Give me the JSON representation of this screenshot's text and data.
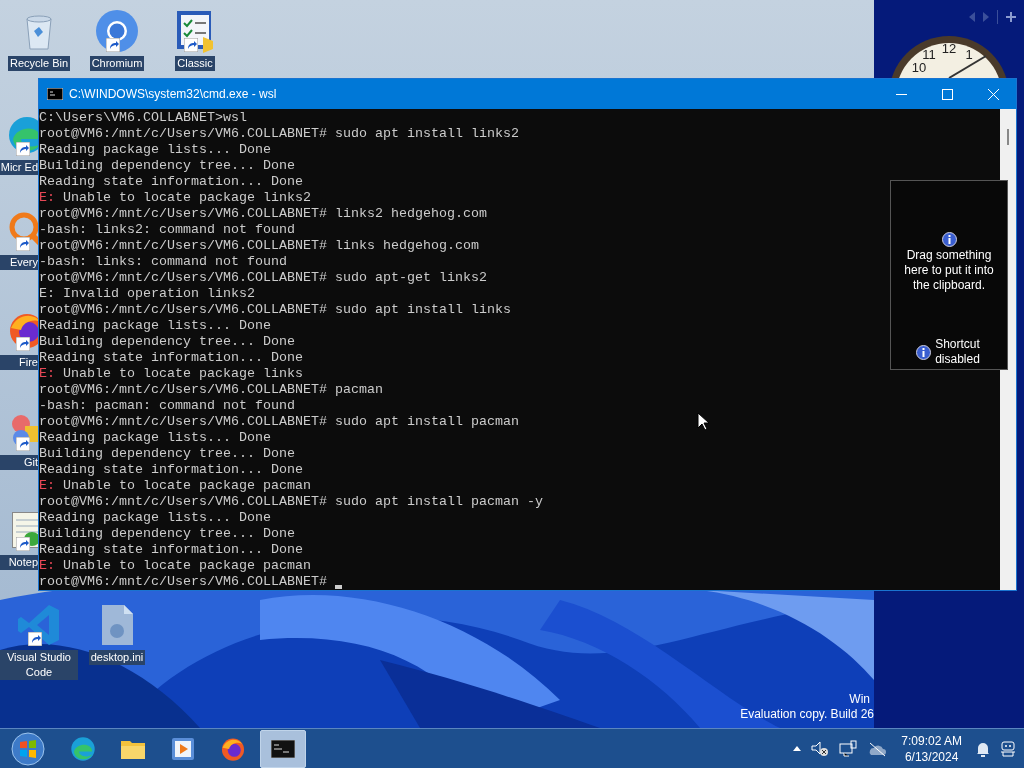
{
  "desktop": {
    "icons": [
      {
        "kind": "bin",
        "label": "Recycle Bin",
        "shortcut": false,
        "cut": false
      },
      {
        "kind": "chromium",
        "label": "Chromium",
        "shortcut": true,
        "cut": false
      },
      {
        "kind": "checklist",
        "label": "Classic",
        "shortcut": true,
        "cut": false
      },
      {
        "kind": "edge",
        "label": "Micr Ed",
        "shortcut": true,
        "cut": true
      },
      {
        "kind": "search",
        "label": "Every",
        "shortcut": true,
        "cut": true
      },
      {
        "kind": "firefox",
        "label": "Fire",
        "shortcut": true,
        "cut": true
      },
      {
        "kind": "git",
        "label": "Git",
        "shortcut": true,
        "cut": true
      },
      {
        "kind": "notepad",
        "label": "Notep",
        "shortcut": true,
        "cut": true
      },
      {
        "kind": "vscode",
        "label": "Visual Studio Code",
        "shortcut": true,
        "cut": false
      },
      {
        "kind": "file",
        "label": "desktop.ini",
        "shortcut": false,
        "cut": false
      }
    ],
    "watermark": [
      "Win",
      "Evaluation copy. Build 26"
    ]
  },
  "gadgets": {
    "clock_numbers": [
      "10",
      "11",
      "12",
      "1"
    ],
    "clipboard": {
      "message": "Drag something here to put it into the clipboard.",
      "status": "Shortcut disabled"
    }
  },
  "terminal": {
    "title": "C:\\WINDOWS\\system32\\cmd.exe - wsl",
    "lines": [
      {
        "kind": "plain",
        "text": "C:\\Users\\VM6.COLLABNET>wsl"
      },
      {
        "kind": "plain",
        "text": "root@VM6:/mnt/c/Users/VM6.COLLABNET# sudo apt install links2"
      },
      {
        "kind": "plain",
        "text": "Reading package lists... Done"
      },
      {
        "kind": "plain",
        "text": "Building dependency tree... Done"
      },
      {
        "kind": "plain",
        "text": "Reading state information... Done"
      },
      {
        "kind": "error",
        "prefix": "E:",
        "text": " Unable to locate package links2"
      },
      {
        "kind": "plain",
        "text": "root@VM6:/mnt/c/Users/VM6.COLLABNET# links2 hedgehog.com"
      },
      {
        "kind": "plain",
        "text": "-bash: links2: command not found"
      },
      {
        "kind": "plain",
        "text": "root@VM6:/mnt/c/Users/VM6.COLLABNET# links hedgehog.com"
      },
      {
        "kind": "plain",
        "text": "-bash: links: command not found"
      },
      {
        "kind": "plain",
        "text": "root@VM6:/mnt/c/Users/VM6.COLLABNET# sudo apt-get links2"
      },
      {
        "kind": "plain",
        "text": "E: Invalid operation links2"
      },
      {
        "kind": "plain",
        "text": "root@VM6:/mnt/c/Users/VM6.COLLABNET# sudo apt install links"
      },
      {
        "kind": "plain",
        "text": "Reading package lists... Done"
      },
      {
        "kind": "plain",
        "text": "Building dependency tree... Done"
      },
      {
        "kind": "plain",
        "text": "Reading state information... Done"
      },
      {
        "kind": "error",
        "prefix": "E:",
        "text": " Unable to locate package links"
      },
      {
        "kind": "plain",
        "text": "root@VM6:/mnt/c/Users/VM6.COLLABNET# pacman"
      },
      {
        "kind": "plain",
        "text": "-bash: pacman: command not found"
      },
      {
        "kind": "plain",
        "text": "root@VM6:/mnt/c/Users/VM6.COLLABNET# sudo apt install pacman"
      },
      {
        "kind": "plain",
        "text": "Reading package lists... Done"
      },
      {
        "kind": "plain",
        "text": "Building dependency tree... Done"
      },
      {
        "kind": "plain",
        "text": "Reading state information... Done"
      },
      {
        "kind": "error",
        "prefix": "E:",
        "text": " Unable to locate package pacman"
      },
      {
        "kind": "plain",
        "text": "root@VM6:/mnt/c/Users/VM6.COLLABNET# sudo apt install pacman -y"
      },
      {
        "kind": "plain",
        "text": "Reading package lists... Done"
      },
      {
        "kind": "plain",
        "text": "Building dependency tree... Done"
      },
      {
        "kind": "plain",
        "text": "Reading state information... Done"
      },
      {
        "kind": "error",
        "prefix": "E:",
        "text": " Unable to locate package pacman"
      },
      {
        "kind": "prompt",
        "text": "root@VM6:/mnt/c/Users/VM6.COLLABNET# "
      }
    ]
  },
  "taskbar": {
    "apps": [
      {
        "kind": "edge",
        "selected": false
      },
      {
        "kind": "folder",
        "selected": false
      },
      {
        "kind": "player",
        "selected": false
      },
      {
        "kind": "firefox",
        "selected": false
      },
      {
        "kind": "console",
        "selected": true
      }
    ],
    "time": "7:09:02 AM",
    "date": "6/13/2024"
  }
}
